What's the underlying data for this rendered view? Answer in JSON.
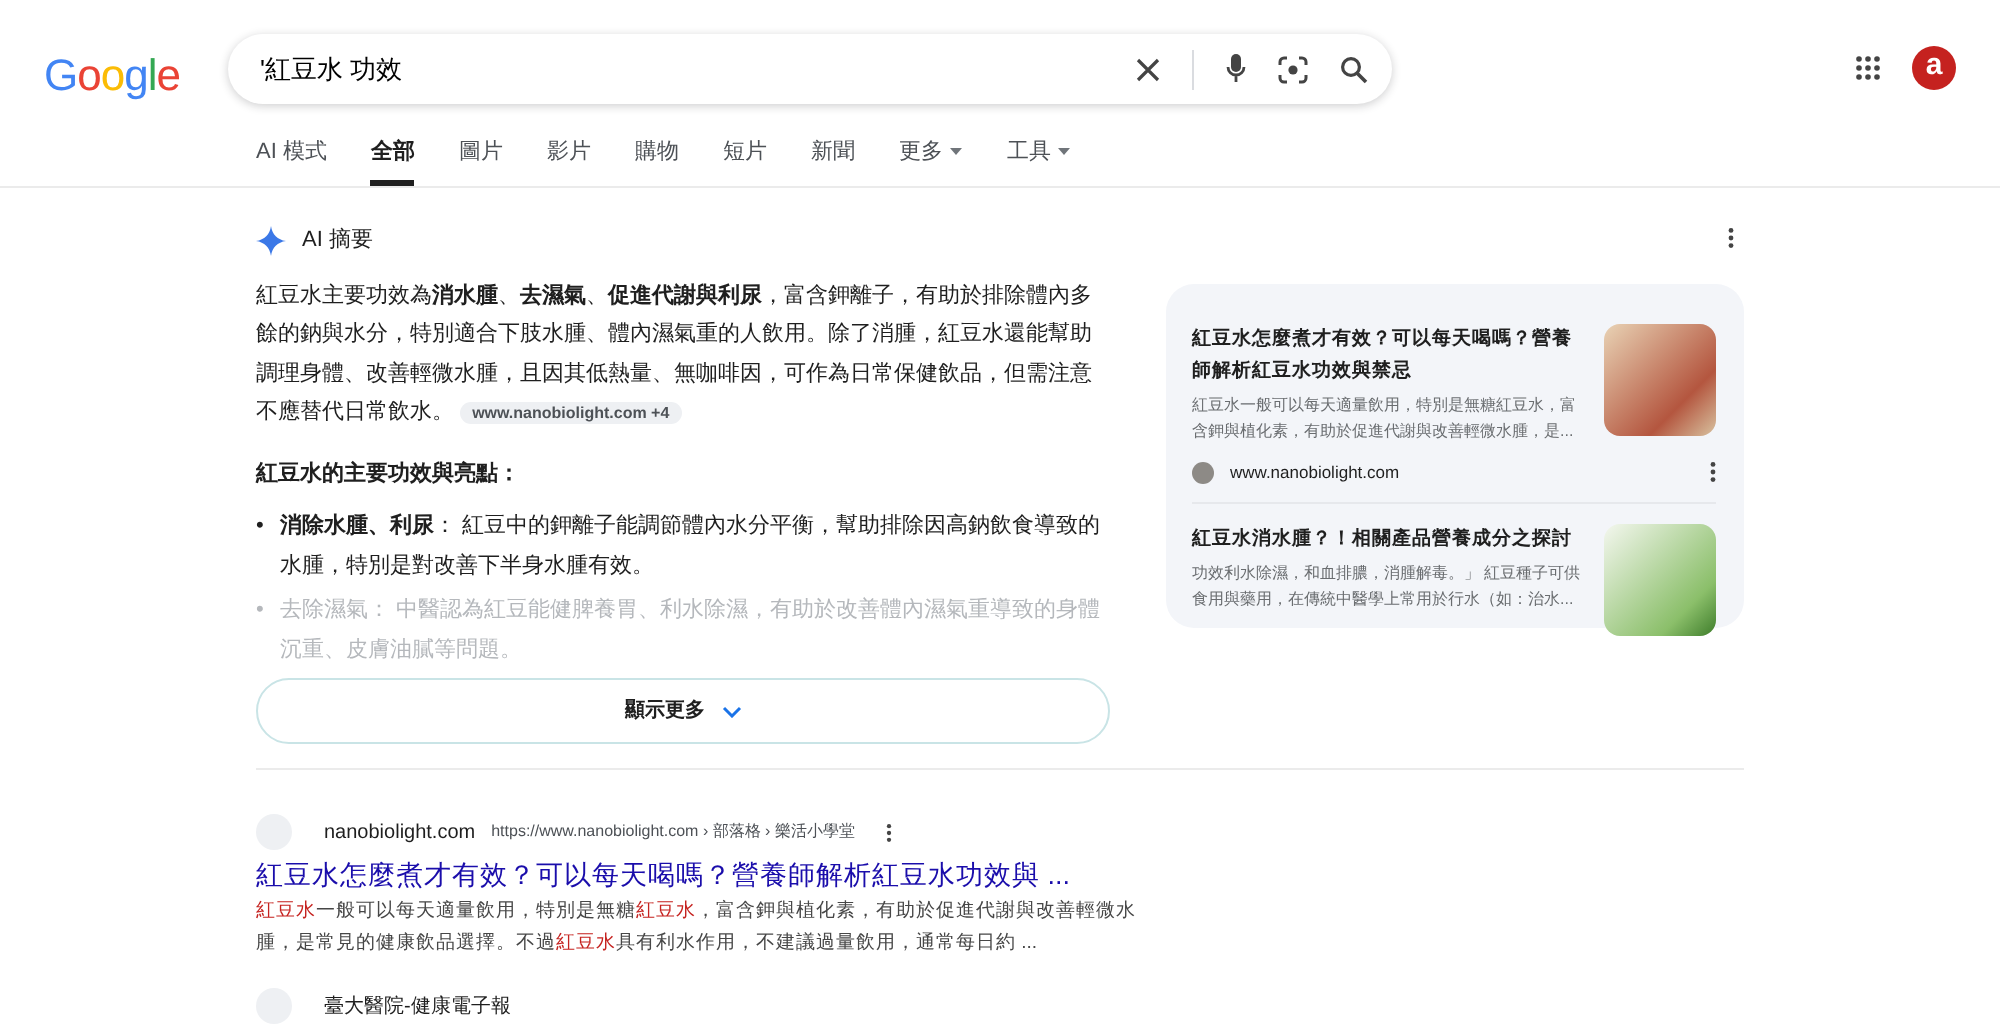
{
  "logo": "Google",
  "search": {
    "value": "'紅豆水 功效"
  },
  "avatar": {
    "letter": "a"
  },
  "tabs": [
    {
      "label": "AI 模式",
      "selected": false,
      "dropdown": false
    },
    {
      "label": "全部",
      "selected": true,
      "dropdown": false
    },
    {
      "label": "圖片",
      "selected": false,
      "dropdown": false
    },
    {
      "label": "影片",
      "selected": false,
      "dropdown": false
    },
    {
      "label": "購物",
      "selected": false,
      "dropdown": false
    },
    {
      "label": "短片",
      "selected": false,
      "dropdown": false
    },
    {
      "label": "新聞",
      "selected": false,
      "dropdown": false
    },
    {
      "label": "更多",
      "selected": false,
      "dropdown": true
    },
    {
      "label": "工具",
      "selected": false,
      "dropdown": true
    }
  ],
  "ai_overview": {
    "title": "AI 摘要",
    "summary": "紅豆水主要功效為**消水腫**、**去濕氣**、**促進代謝與利尿**，富含鉀離子，有助於排除體內多餘的鈉與水分，特別適合下肢水腫、體內濕氣重的人飲用。除了消腫，紅豆水還能幫助調理身體、改善輕微水腫，且因其低熱量、無咖啡因，可作為日常保健飲品，但需注意不應替代日常飲水。",
    "source_chip": "www.nanobiolight.com +4",
    "heading": "紅豆水的主要功效與亮點：",
    "bullets": [
      {
        "marker": "•",
        "text": "**消除水腫、利尿**： 紅豆中的鉀離子能調節體內水分平衡，幫助排除因高鈉飲食導致的水腫，特別是對改善下半身水腫有效。",
        "faded": false
      },
      {
        "marker": "•",
        "text": "去除濕氣： 中醫認為紅豆能健脾養胃、利水除濕，有助於改善體內濕氣重導致的身體沉重、皮膚油膩等問題。",
        "faded": true
      }
    ],
    "show_more": "顯示更多",
    "sources": [
      {
        "title": "紅豆水怎麼煮才有效？可以每天喝嗎？營養師解析紅豆水功效與禁忌",
        "snippet": "紅豆水一般可以每天適量飲用，特別是無糖紅豆水，富含鉀與植化素，有助於促進代謝與改善輕微水腫，是...",
        "site": "www.nanobiolight.com"
      },
      {
        "title": "紅豆水消水腫？！相關產品營養成分之探討",
        "snippet": "功效利水除濕，和血排膿，消腫解毒。」 紅豆種子可供食用與藥用，在傳統中醫學上常用於行水（如：治水..."
      }
    ]
  },
  "results": [
    {
      "site": "nanobiolight.com",
      "url": "https://www.nanobiolight.com › 部落格 › 樂活小學堂",
      "title": "紅豆水怎麼煮才有效？可以每天喝嗎？營養師解析紅豆水功效與 ...",
      "snippet": [
        {
          "text": "紅豆水",
          "highlight": true
        },
        {
          "text": "一般可以每天適量飲用，特別是無糖",
          "highlight": false
        },
        {
          "text": "紅豆水",
          "highlight": true
        },
        {
          "text": "，富含鉀與植化素，有助於促進代謝與改善輕微水腫，是常見的健康飲品選擇。不過",
          "highlight": false
        },
        {
          "text": "紅豆水",
          "highlight": true
        },
        {
          "text": "具有利水作用，不建議過量飲用，通常每日約 ...",
          "highlight": false
        }
      ]
    },
    {
      "site": "臺大醫院-健康電子報"
    }
  ]
}
